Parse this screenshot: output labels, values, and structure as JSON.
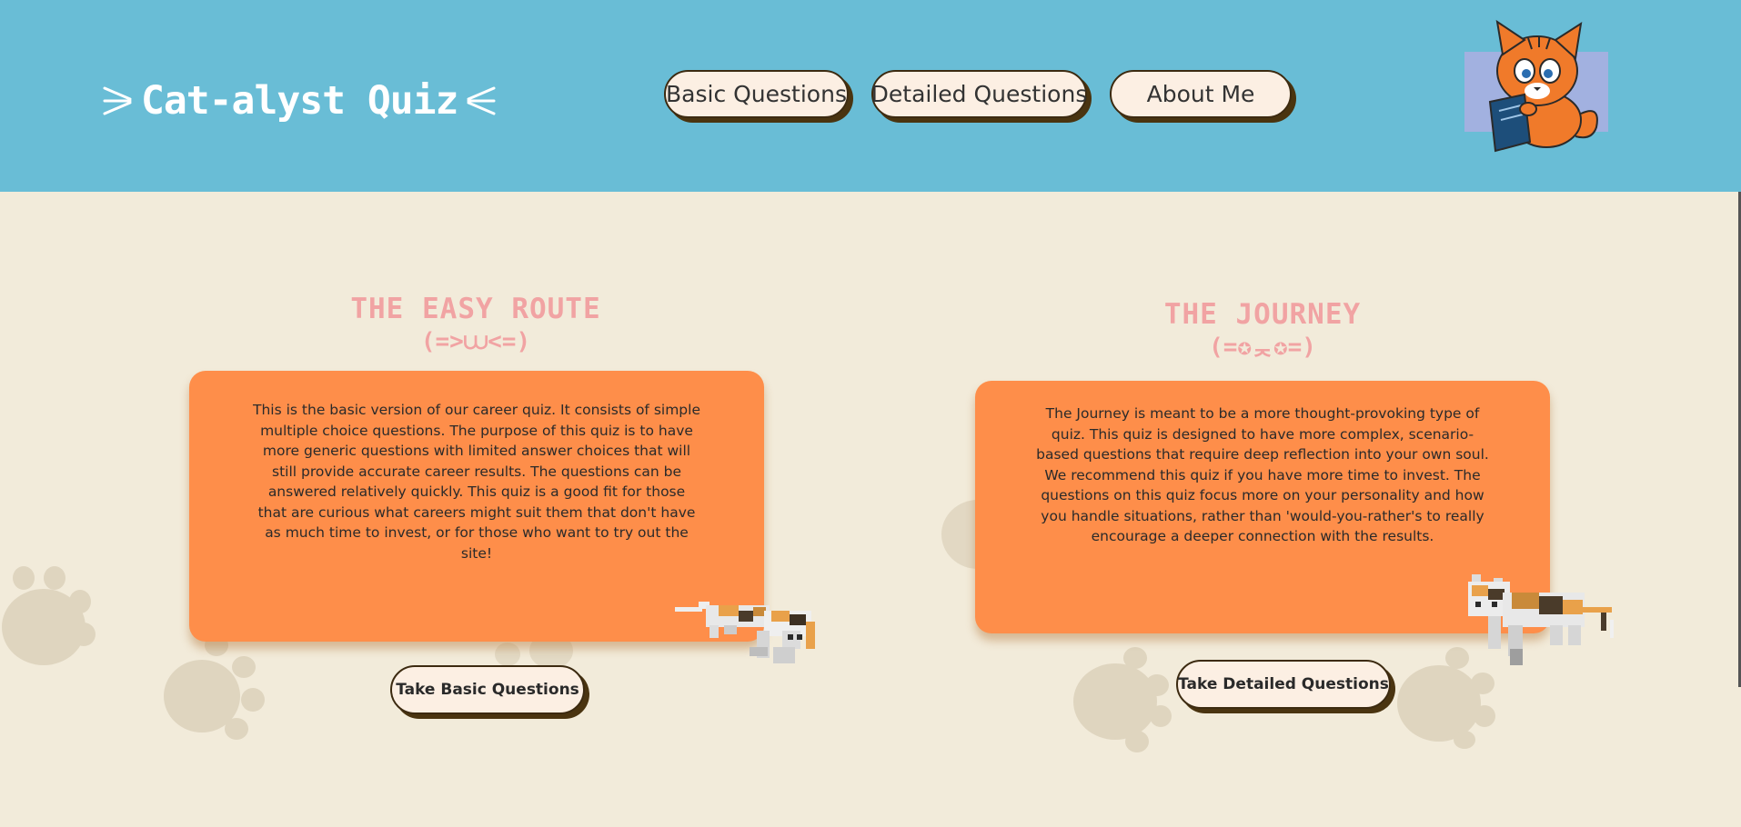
{
  "header": {
    "logo_text": "Cat-alyst Quiz",
    "nav": [
      {
        "label": "Basic Questions"
      },
      {
        "label": "Detailed Questions"
      },
      {
        "label": "About Me"
      }
    ]
  },
  "sections": {
    "easy": {
      "title": "THE EASY ROUTE",
      "emoticon": "(=>⩊<=)",
      "description": "This is the basic version of our career quiz. It consists of simple multiple choice questions. The purpose of this quiz is to have more generic questions with limited answer choices that will still provide accurate career results. The questions can be answered relatively quickly. This quiz is a good fit for those that are curious what careers might suit them that don't have as much time to invest, or for those who want to try out the site!",
      "button": "Take Basic Questions"
    },
    "journey": {
      "title": "THE JOURNEY",
      "emoticon": "(=✪ᆽ✪=)",
      "description": "The Journey is meant to be a more thought-provoking type of quiz. This quiz is designed to have more complex, scenario-based questions that require deep reflection into your own soul. We recommend this quiz if you have more time to invest. The questions on this quiz focus more on your personality and how you handle situations, rather than 'would-you-rather's to really encourage a deeper connection with the results.",
      "button": "Take Detailed Questions"
    }
  },
  "colors": {
    "header_bg": "#69bdd6",
    "page_bg": "#f2ebda",
    "card_bg": "#fe8e4a",
    "title_pink": "#f1a3a3",
    "button_bg": "#fcefe3",
    "button_shadow": "#4a3410"
  },
  "icons": {
    "mascot": "cat-reading-book-icon",
    "paw": "paw-print-icon",
    "pixel_cat": "pixel-calico-cat-icon"
  }
}
